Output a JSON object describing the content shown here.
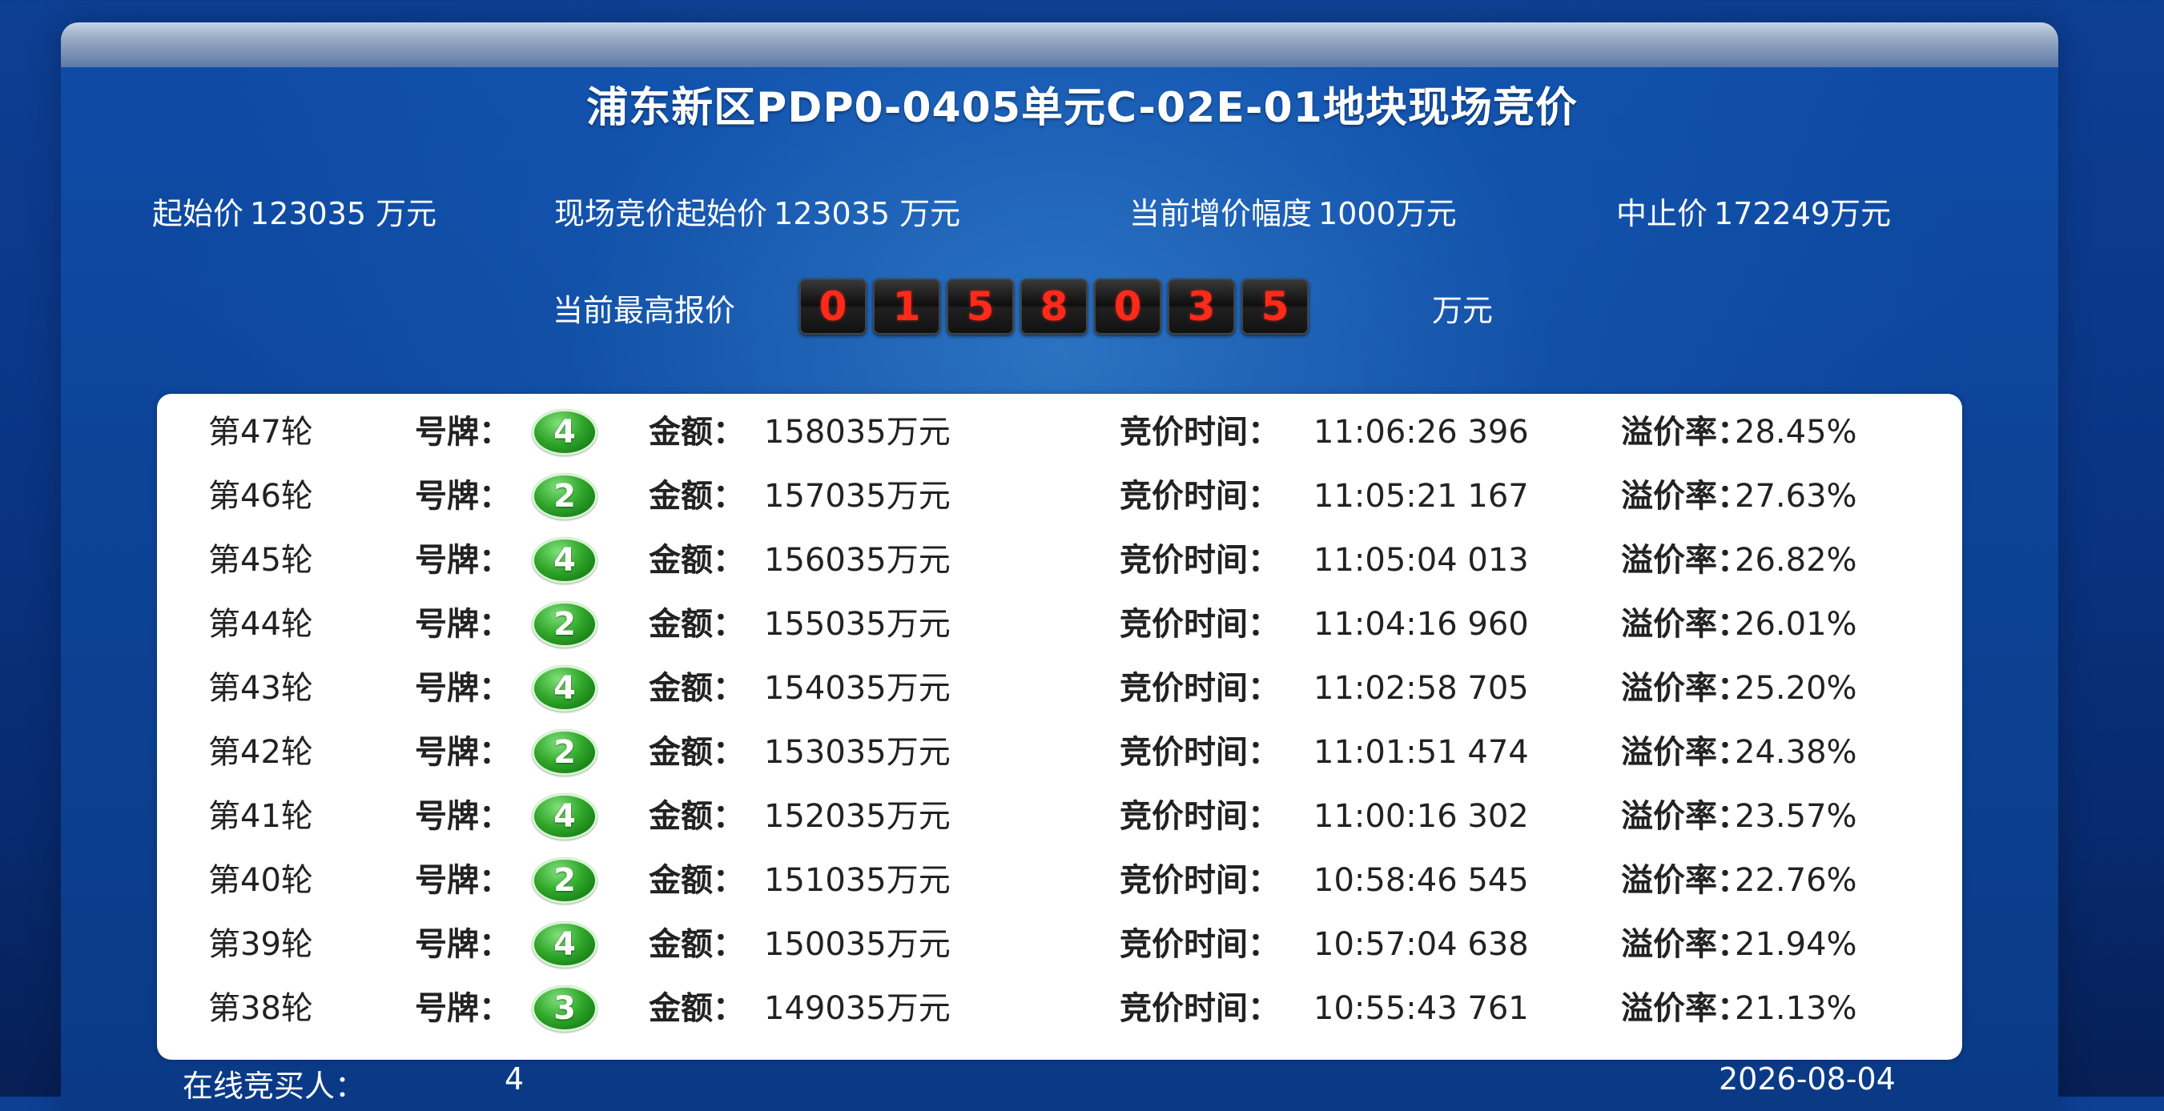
{
  "title": "浦东新区PDP0-0405单元C-02E-01地块现场竞价",
  "info": {
    "start_price_label": "起始价",
    "start_price_value": "123035 万元",
    "onsite_start_label": "现场竞价起始价",
    "onsite_start_value": "123035 万元",
    "increment_label": "当前增价幅度",
    "increment_value": "1000万元",
    "stop_price_label": "中止价",
    "stop_price_value": "172249万元"
  },
  "highest": {
    "label": "当前最高报价",
    "digits": [
      "0",
      "1",
      "5",
      "8",
      "0",
      "3",
      "5"
    ],
    "unit": "万元"
  },
  "labels": {
    "plate": "号牌：",
    "amount": "金额：",
    "time": "竞价时间：",
    "rate": "溢价率："
  },
  "bids": [
    {
      "round": "第47轮",
      "plate": "4",
      "amount": "158035万元",
      "time": "11:06:26 396",
      "rate": "28.45%"
    },
    {
      "round": "第46轮",
      "plate": "2",
      "amount": "157035万元",
      "time": "11:05:21 167",
      "rate": "27.63%"
    },
    {
      "round": "第45轮",
      "plate": "4",
      "amount": "156035万元",
      "time": "11:05:04 013",
      "rate": "26.82%"
    },
    {
      "round": "第44轮",
      "plate": "2",
      "amount": "155035万元",
      "time": "11:04:16 960",
      "rate": "26.01%"
    },
    {
      "round": "第43轮",
      "plate": "4",
      "amount": "154035万元",
      "time": "11:02:58 705",
      "rate": "25.20%"
    },
    {
      "round": "第42轮",
      "plate": "2",
      "amount": "153035万元",
      "time": "11:01:51 474",
      "rate": "24.38%"
    },
    {
      "round": "第41轮",
      "plate": "4",
      "amount": "152035万元",
      "time": "11:00:16 302",
      "rate": "23.57%"
    },
    {
      "round": "第40轮",
      "plate": "2",
      "amount": "151035万元",
      "time": "10:58:46 545",
      "rate": "22.76%"
    },
    {
      "round": "第39轮",
      "plate": "4",
      "amount": "150035万元",
      "time": "10:57:04 638",
      "rate": "21.94%"
    },
    {
      "round": "第38轮",
      "plate": "3",
      "amount": "149035万元",
      "time": "10:55:43 761",
      "rate": "21.13%"
    }
  ],
  "footer": {
    "online_label": "在线竞买人：",
    "online_count": "4",
    "date": "2026-08-04"
  }
}
